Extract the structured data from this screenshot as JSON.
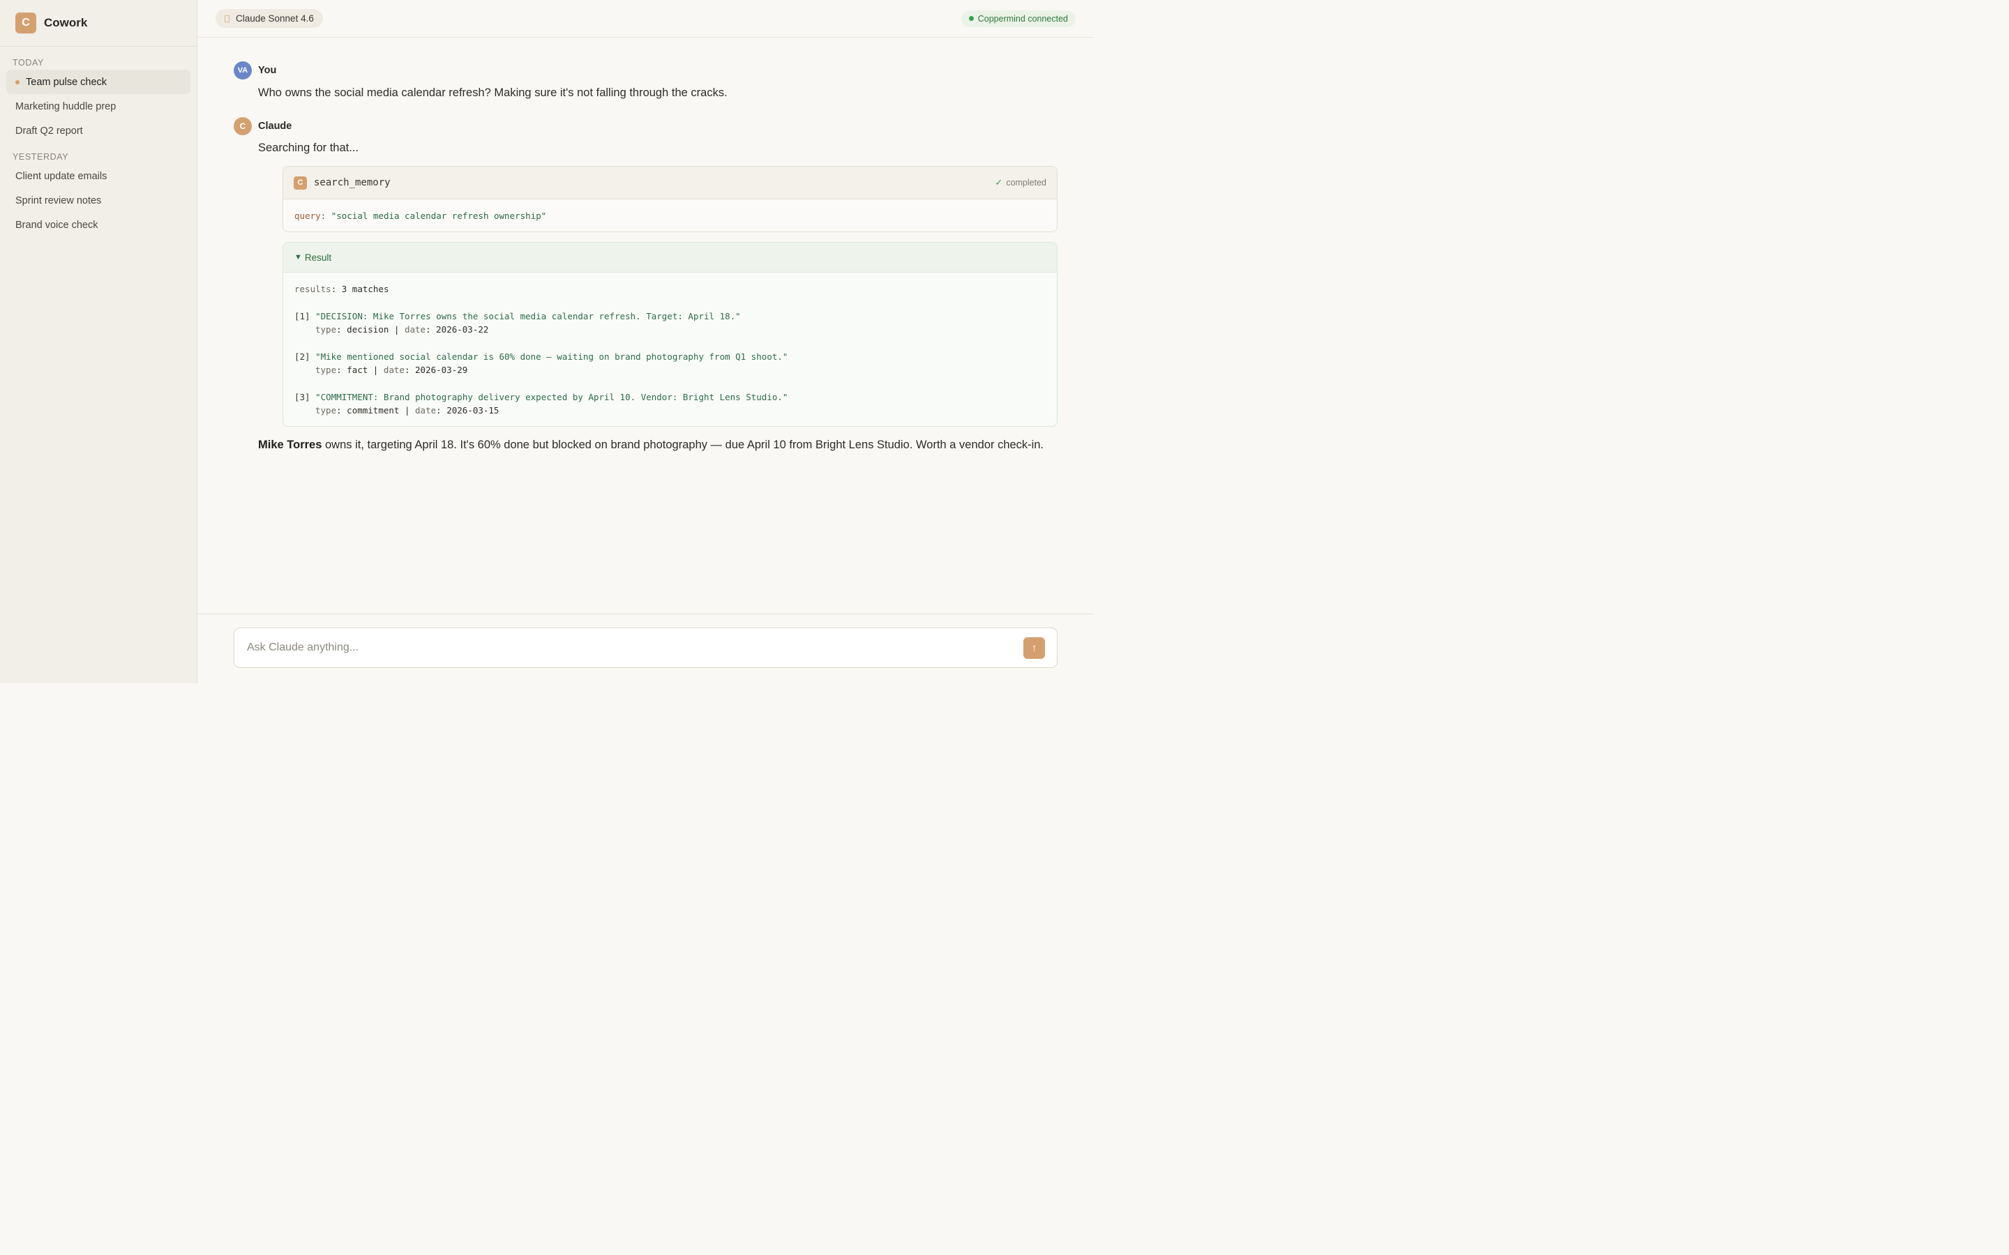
{
  "app": {
    "logo_letter": "C",
    "name": "Cowork"
  },
  "sidebar": {
    "sections": [
      {
        "label": "TODAY",
        "items": [
          {
            "label": "Team pulse check",
            "active": true
          },
          {
            "label": "Marketing huddle prep",
            "active": false
          },
          {
            "label": "Draft Q2 report",
            "active": false
          }
        ]
      },
      {
        "label": "YESTERDAY",
        "items": [
          {
            "label": "Client update emails",
            "active": false
          },
          {
            "label": "Sprint review notes",
            "active": false
          },
          {
            "label": "Brand voice check",
            "active": false
          }
        ]
      }
    ]
  },
  "topbar": {
    "model": "Claude Sonnet 4.6",
    "connection_status": "Coppermind connected"
  },
  "thread": {
    "user": {
      "avatar": "VA",
      "author": "You",
      "text": "Who owns the social media calendar refresh? Making sure it's not falling through the cracks."
    },
    "assistant": {
      "avatar": "C",
      "author": "Claude",
      "intro": "Searching for that...",
      "tool": {
        "badge": "C",
        "name": "search_memory",
        "status": "completed",
        "query_key": "query",
        "query_value": "\"social media calendar refresh ownership\""
      },
      "result": {
        "header": "Result",
        "summary_key": "results",
        "summary_value": "3 matches",
        "entries": [
          {
            "index": "[1]",
            "text": "\"DECISION: Mike Torres owns the social media calendar refresh. Target: April 18.\"",
            "type": "decision",
            "date": "2026-03-22"
          },
          {
            "index": "[2]",
            "text": "\"Mike mentioned social calendar is 60% done — waiting on brand photography from Q1 shoot.\"",
            "type": "fact",
            "date": "2026-03-29"
          },
          {
            "index": "[3]",
            "text": "\"COMMITMENT: Brand photography delivery expected by April 10. Vendor: Bright Lens Studio.\"",
            "type": "commitment",
            "date": "2026-03-15"
          }
        ],
        "type_key": "type",
        "date_key": "date"
      },
      "answer_bold": "Mike Torres",
      "answer_rest": " owns it, targeting April 18. It's 60% done but blocked on brand photography — due April 10 from Bright Lens Studio. Worth a vendor check-in."
    }
  },
  "composer": {
    "placeholder": "Ask Claude anything...",
    "value": ""
  },
  "icons": {
    "send": "arrow-up-icon",
    "check": "check-icon",
    "model": "model-icon",
    "status": "green-dot-icon",
    "expand": "triangle-down-icon"
  },
  "colors": {
    "accent": "#d4a070",
    "user_avatar": "#6b86c8",
    "connected_green": "#3aa04e"
  }
}
